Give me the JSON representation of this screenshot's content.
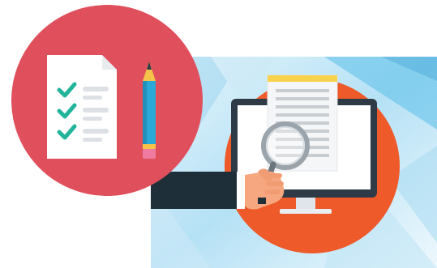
{
  "illustration": {
    "checklist_icon": "checklist-icon",
    "pencil_icon": "pencil-icon",
    "monitor_icon": "computer-monitor-icon",
    "document_icon": "document-icon",
    "magnifier_icon": "magnifying-glass-icon",
    "hand_icon": "hand-holding-magnifier-icon"
  },
  "colors": {
    "badge": "#e0505c",
    "check": "#22b49a",
    "pencil": "#2aa8d8",
    "pencil_tip": "#f5c24a",
    "pencil_eraser": "#f07aa0",
    "banner_light": "#d8eef8",
    "banner_mid": "#9fd6f0",
    "banner_dark": "#4fb8e6",
    "orange_disc": "#ee5a2a",
    "monitor_frame": "#2e3b46",
    "document_header": "#f7d24a",
    "sleeve": "#1f2f39",
    "skin": "#f7a77f"
  }
}
